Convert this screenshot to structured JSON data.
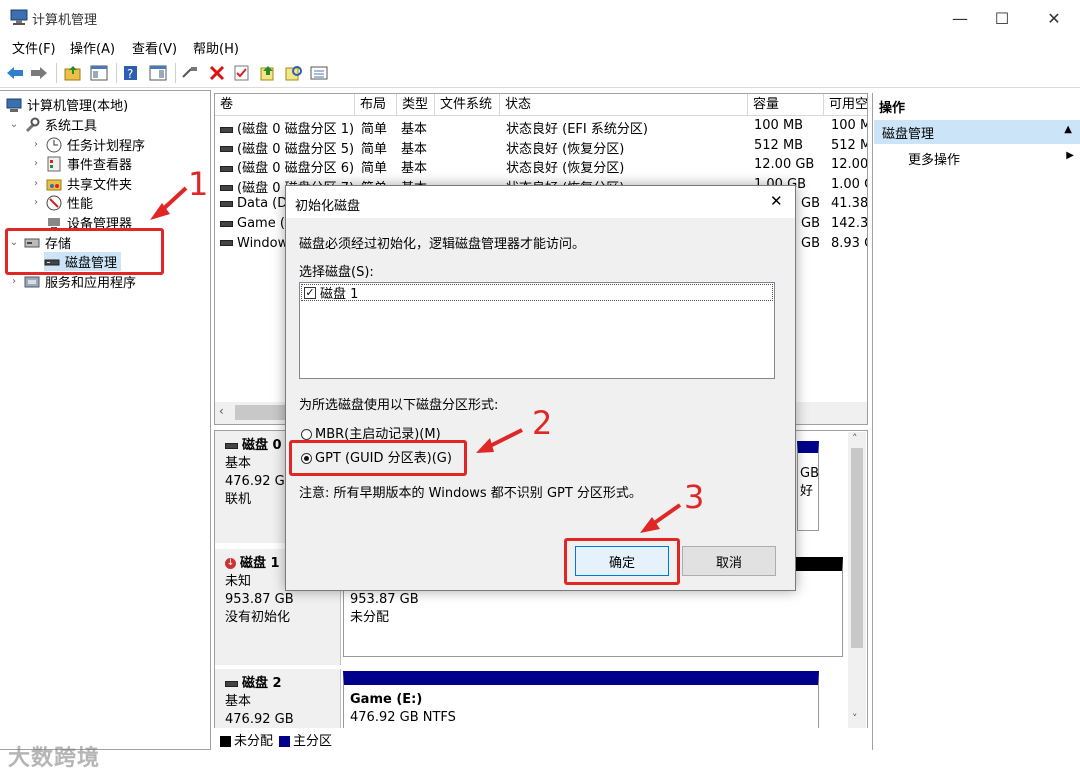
{
  "window": {
    "title": "计算机管理",
    "minimize": "—",
    "maximize": "☐",
    "close": "✕"
  },
  "menu": [
    "文件(F)",
    "操作(A)",
    "查看(V)",
    "帮助(H)"
  ],
  "tree": {
    "root": "计算机管理(本地)",
    "system_tools": "系统工具",
    "task_scheduler": "任务计划程序",
    "event_viewer": "事件查看器",
    "shared_folders": "共享文件夹",
    "performance": "性能",
    "device_manager": "设备管理器",
    "storage": "存储",
    "disk_management": "磁盘管理",
    "services_apps": "服务和应用程序"
  },
  "volumes": {
    "headers": [
      "卷",
      "布局",
      "类型",
      "文件系统",
      "状态",
      "容量",
      "可用空"
    ],
    "rows": [
      [
        "(磁盘 0 磁盘分区 1)",
        "简单",
        "基本",
        "",
        "状态良好 (EFI 系统分区)",
        "100 MB",
        "100 M"
      ],
      [
        "(磁盘 0 磁盘分区 5)",
        "简单",
        "基本",
        "",
        "状态良好 (恢复分区)",
        "512 MB",
        "512 M"
      ],
      [
        "(磁盘 0 磁盘分区 6)",
        "简单",
        "基本",
        "",
        "状态良好 (恢复分区)",
        "12.00 GB",
        "12.00"
      ],
      [
        "(磁盘 0 磁盘分区 7)",
        "简单",
        "基本",
        "",
        "状态良好 (恢复分区)",
        "1.00 GB",
        "1.00 C"
      ],
      [
        "Data (D",
        "",
        "",
        "",
        "",
        "GB",
        "41.38"
      ],
      [
        "Game (I",
        "",
        "",
        "",
        "",
        "GB",
        "142.3"
      ],
      [
        "Window",
        "",
        "",
        "",
        "",
        "GB",
        "8.93 C"
      ]
    ]
  },
  "disks": [
    {
      "name": "磁盘 0",
      "type": "基本",
      "size": "476.92 GB",
      "status": "联机",
      "right_a": "GB",
      "right_b": "好"
    },
    {
      "name": "磁盘 1",
      "type": "未知",
      "size": "953.87 GB",
      "status": "没有初始化",
      "part_size": "953.87 GB",
      "part_state": "未分配"
    },
    {
      "name": "磁盘 2",
      "type": "基本",
      "size": "476.92 GB",
      "part_name": "Game  (E:)",
      "part_size": "476.92 GB NTFS"
    }
  ],
  "legend": {
    "unallocated": "未分配",
    "primary": "主分区"
  },
  "actions": {
    "header": "操作",
    "section": "磁盘管理",
    "more": "更多操作"
  },
  "dialog": {
    "title": "初始化磁盘",
    "message": "磁盘必须经过初始化，逻辑磁盘管理器才能访问。",
    "select_label": "选择磁盘(S):",
    "disk_item": "磁盘 1",
    "style_label": "为所选磁盘使用以下磁盘分区形式:",
    "mbr": "MBR(主启动记录)(M)",
    "gpt": "GPT (GUID 分区表)(G)",
    "note": "注意: 所有早期版本的 Windows 都不识别 GPT 分区形式。",
    "ok": "确定",
    "cancel": "取消"
  },
  "annotations": [
    "1",
    "2",
    "3"
  ],
  "watermark": "大数跨境",
  "colors": {
    "primary_partition": "#00008b",
    "unallocated": "#000000",
    "annotation": "#e12626",
    "selection": "#cce4f7"
  }
}
